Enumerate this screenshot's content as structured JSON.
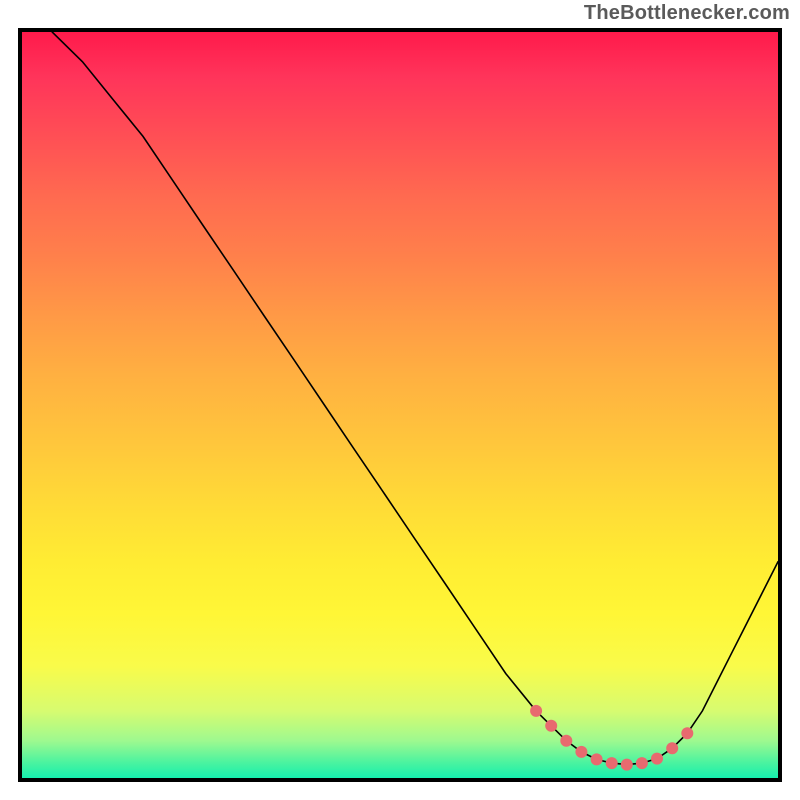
{
  "attribution": "TheBottlenecker.com",
  "chart_data": {
    "type": "line",
    "title": "",
    "xlabel": "",
    "ylabel": "",
    "xlim": [
      0,
      100
    ],
    "ylim": [
      0,
      100
    ],
    "series": [
      {
        "name": "bottleneck-curve",
        "x": [
          4,
          8,
          12,
          16,
          20,
          24,
          28,
          32,
          36,
          40,
          44,
          48,
          52,
          56,
          60,
          64,
          68,
          70,
          72,
          74,
          76,
          78,
          80,
          82,
          84,
          86,
          88,
          90,
          92,
          94,
          96,
          98,
          100
        ],
        "y": [
          100,
          96,
          91,
          86,
          80,
          74,
          68,
          62,
          56,
          50,
          44,
          38,
          32,
          26,
          20,
          14,
          9,
          7,
          5,
          3.5,
          2.5,
          2,
          1.8,
          2,
          2.6,
          4,
          6,
          9,
          13,
          17,
          21,
          25,
          29
        ]
      }
    ],
    "markers": {
      "name": "optimal-range-markers",
      "x": [
        68,
        70,
        72,
        74,
        76,
        78,
        80,
        82,
        84,
        86,
        88
      ],
      "y": [
        9,
        7,
        5,
        3.5,
        2.5,
        2,
        1.8,
        2,
        2.6,
        4,
        6
      ]
    },
    "background_gradient": {
      "stops": [
        {
          "pos": 0.0,
          "color": "#ff1a4b"
        },
        {
          "pos": 0.5,
          "color": "#ffc63c"
        },
        {
          "pos": 0.8,
          "color": "#fff636"
        },
        {
          "pos": 1.0,
          "color": "#16efae"
        }
      ]
    }
  }
}
